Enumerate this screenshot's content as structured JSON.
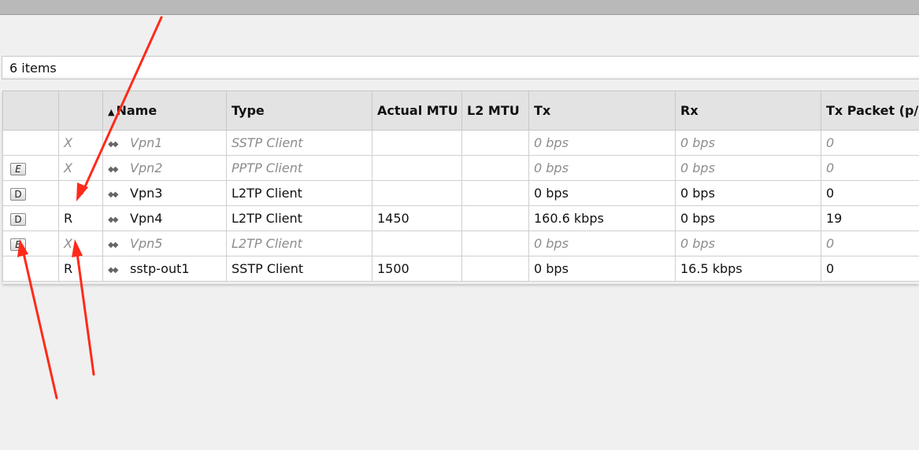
{
  "list": {
    "items_count": "6 items"
  },
  "table": {
    "columns": [
      "",
      "",
      "Name",
      "Type",
      "Actual MTU",
      "L2 MTU",
      "Tx",
      "Rx",
      "Tx Packet (p/"
    ],
    "sort_indicator": "▲",
    "rows": [
      {
        "button": "",
        "flag": "X",
        "name": "Vpn1",
        "type": "SSTP Client",
        "actual_mtu": "",
        "l2_mtu": "",
        "tx": "0 bps",
        "rx": "0 bps",
        "tx_packet": "0",
        "disabled": true
      },
      {
        "button": "E",
        "flag": "X",
        "name": "Vpn2",
        "type": "PPTP Client",
        "actual_mtu": "",
        "l2_mtu": "",
        "tx": "0 bps",
        "rx": "0 bps",
        "tx_packet": "0",
        "disabled": true
      },
      {
        "button": "D",
        "flag": "",
        "name": "Vpn3",
        "type": "L2TP Client",
        "actual_mtu": "",
        "l2_mtu": "",
        "tx": "0 bps",
        "rx": "0 bps",
        "tx_packet": "0",
        "disabled": false
      },
      {
        "button": "D",
        "flag": "R",
        "name": "Vpn4",
        "type": "L2TP Client",
        "actual_mtu": "1450",
        "l2_mtu": "",
        "tx": "160.6 kbps",
        "rx": "0 bps",
        "tx_packet": "19",
        "disabled": false
      },
      {
        "button": "E",
        "flag": "X",
        "name": "Vpn5",
        "type": "L2TP Client",
        "actual_mtu": "",
        "l2_mtu": "",
        "tx": "0 bps",
        "rx": "0 bps",
        "tx_packet": "0",
        "disabled": true
      },
      {
        "button": "",
        "flag": "R",
        "name": "sstp-out1",
        "type": "SSTP Client",
        "actual_mtu": "1500",
        "l2_mtu": "",
        "tx": "0 bps",
        "rx": "16.5 kbps",
        "tx_packet": "0",
        "disabled": false
      }
    ]
  },
  "icons": {
    "interface": "interface-icon",
    "sort": "sort-ascending-icon"
  },
  "colors": {
    "annotation_arrow": "#ff2a1a",
    "disabled_text": "#8c8c8c",
    "header_bg": "#e3e3e3"
  }
}
